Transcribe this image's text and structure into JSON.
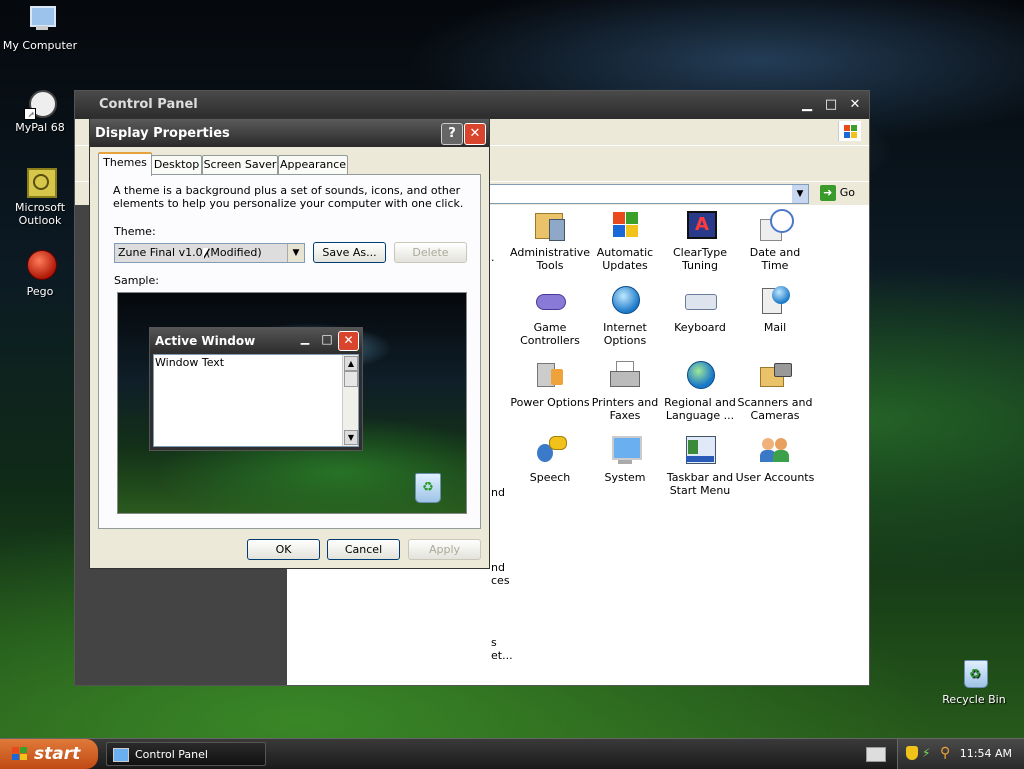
{
  "desktop": {
    "icons": [
      {
        "label": "My Computer",
        "icon": "computer-icon"
      },
      {
        "label": "MyPal 68",
        "icon": "browser-icon"
      },
      {
        "label": "Microsoft Outlook",
        "icon": "outlook-icon"
      },
      {
        "label": "Pego",
        "icon": "pego-icon"
      },
      {
        "label": "Recycle Bin",
        "icon": "recycle-bin-icon"
      }
    ]
  },
  "control_panel": {
    "title": "Control Panel",
    "address_go": "Go",
    "items": [
      {
        "label": "Administrative Tools",
        "icon": "admin-tools-icon"
      },
      {
        "label": "Automatic Updates",
        "icon": "windows-update-icon"
      },
      {
        "label": "ClearType Tuning",
        "icon": "cleartype-icon"
      },
      {
        "label": "Date and Time",
        "icon": "clock-icon"
      },
      {
        "label": "Game Controllers",
        "icon": "gamepad-icon"
      },
      {
        "label": "Internet Options",
        "icon": "globe-icon"
      },
      {
        "label": "Keyboard",
        "icon": "keyboard-icon"
      },
      {
        "label": "Mail",
        "icon": "mail-icon"
      },
      {
        "label": "Power Options",
        "icon": "power-icon"
      },
      {
        "label": "Printers and Faxes",
        "icon": "printer-icon"
      },
      {
        "label": "Regional and Language ...",
        "icon": "globe-icon"
      },
      {
        "label": "Scanners and Cameras",
        "icon": "scanner-icon"
      },
      {
        "label": "Speech",
        "icon": "speech-icon"
      },
      {
        "label": "System",
        "icon": "system-icon"
      },
      {
        "label": "Taskbar and Start Menu",
        "icon": "taskbar-icon"
      },
      {
        "label": "User Accounts",
        "icon": "users-icon"
      }
    ],
    "partial_labels": [
      ".",
      "nd",
      "nd",
      "ces",
      "s",
      "et..."
    ]
  },
  "display_properties": {
    "title": "Display Properties",
    "help": "?",
    "close": "✕",
    "tabs": [
      "Themes",
      "Desktop",
      "Screen Saver",
      "Appearance"
    ],
    "description": "A theme is a background plus a set of sounds, icons, and other elements to help you personalize your computer with one click.",
    "theme_label": "Theme:",
    "theme_value": "Zune Final v1.0 (Modified)",
    "save_as": "Save As...",
    "delete": "Delete",
    "sample_label": "Sample:",
    "sample_window": {
      "title": "Active Window",
      "text": "Window Text"
    },
    "ok": "OK",
    "cancel": "Cancel",
    "apply": "Apply"
  },
  "taskbar": {
    "start": "start",
    "task": "Control Panel",
    "clock": "11:54 AM"
  }
}
